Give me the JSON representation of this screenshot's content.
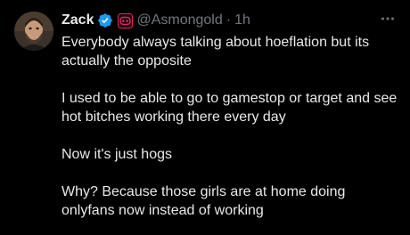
{
  "author": {
    "name": "Zack",
    "handle": "@Asmongold",
    "separator": "·",
    "time": "1h",
    "verified_icon": "verified-badge-icon",
    "affiliation_icon": "affiliation-badge-icon"
  },
  "tweet": {
    "paragraphs": [
      "Everybody always talking about hoeflation but its actually the opposite",
      "I used to be able to go to gamestop or target and see hot bitches working there every day",
      "Now it's just hogs",
      "Why? Because those girls are at home doing onlyfans now instead of working"
    ]
  },
  "icons": {
    "more": "more-options-icon"
  },
  "colors": {
    "background": "#000000",
    "text": "#e7e9ea",
    "muted": "#71767b",
    "verified": "#1d9bf0",
    "affiliation": "#e0245e"
  }
}
